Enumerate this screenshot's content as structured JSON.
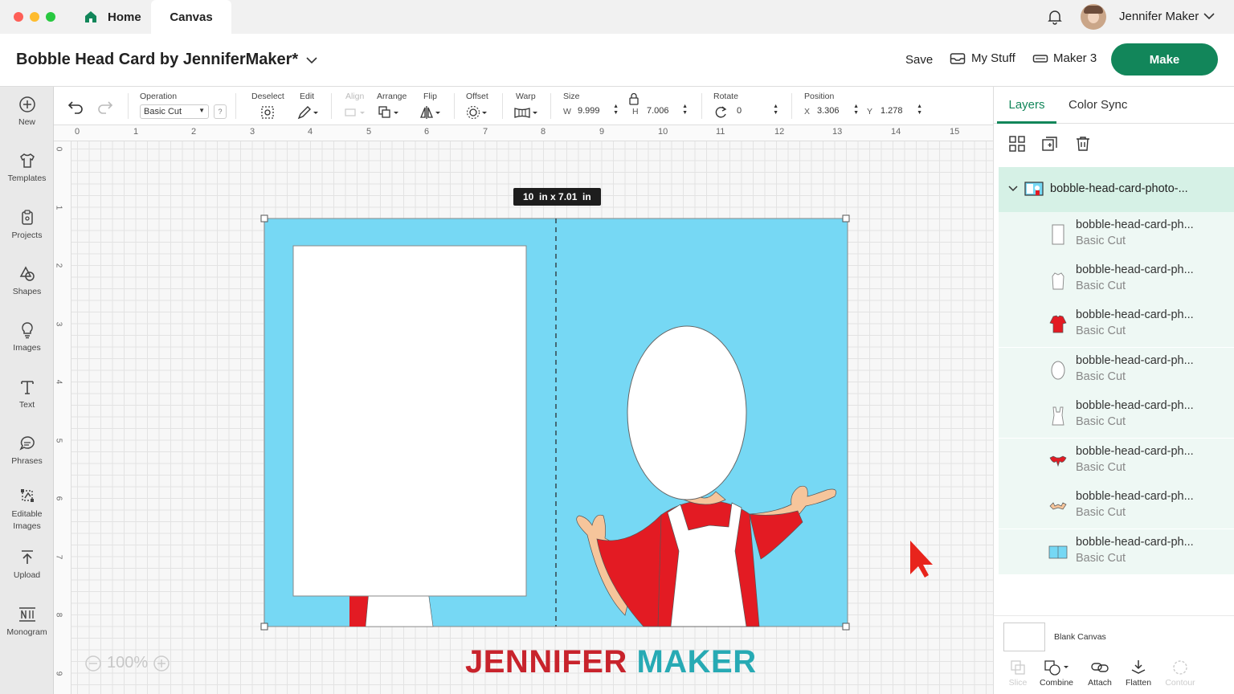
{
  "window": {
    "traffic_lights": {
      "close": "#fe5f57",
      "minimize": "#febc2e",
      "maximize": "#28c840"
    },
    "tabs": [
      {
        "label": "Home",
        "icon": "home-icon"
      },
      {
        "label": "Canvas"
      }
    ],
    "notification_icon": "bell-icon",
    "user_name": "Jennifer Maker"
  },
  "header": {
    "project_title": "Bobble Head Card by JenniferMaker*",
    "save_label": "Save",
    "my_stuff_label": "My Stuff",
    "machine_label": "Maker 3",
    "make_label": "Make",
    "accent_color": "#12865a"
  },
  "sidebar": {
    "items": [
      {
        "label": "New",
        "icon": "plus-circle-icon"
      },
      {
        "label": "Templates",
        "icon": "shirt-icon"
      },
      {
        "label": "Projects",
        "icon": "clipboard-icon"
      },
      {
        "label": "Shapes",
        "icon": "shapes-icon"
      },
      {
        "label": "Images",
        "icon": "lightbulb-icon"
      },
      {
        "label": "Text",
        "icon": "text-icon"
      },
      {
        "label": "Phrases",
        "icon": "speech-bubble-icon"
      },
      {
        "label": "Editable Images",
        "icon": "editable-images-icon"
      },
      {
        "label": "Upload",
        "icon": "upload-icon"
      },
      {
        "label": "Monogram",
        "icon": "monogram-icon"
      }
    ]
  },
  "toolbar": {
    "operation_label": "Operation",
    "operation_value": "Basic Cut",
    "help_label": "?",
    "deselect_label": "Deselect",
    "edit_label": "Edit",
    "align_label": "Align",
    "arrange_label": "Arrange",
    "flip_label": "Flip",
    "offset_label": "Offset",
    "warp_label": "Warp",
    "size_label": "Size",
    "w_label": "W",
    "w_value": "9.999",
    "h_label": "H",
    "h_value": "7.006",
    "rotate_label": "Rotate",
    "rotate_value": "0",
    "position_label": "Position",
    "x_label": "X",
    "x_value": "3.306",
    "y_label": "Y",
    "y_value": "1.278"
  },
  "canvas": {
    "ruler_top": [
      "0",
      "1",
      "2",
      "3",
      "4",
      "5",
      "6",
      "7",
      "8",
      "9",
      "10",
      "11",
      "12",
      "13",
      "14",
      "15"
    ],
    "ruler_left": [
      "0",
      "1",
      "2",
      "3",
      "4",
      "5",
      "6",
      "7",
      "8",
      "9"
    ],
    "size_tooltip": "10  in x 7.01  in",
    "zoom": "100%",
    "card_color": "#76d8f4",
    "watermark_text": "JENNIFERMAKER"
  },
  "panel": {
    "tabs": [
      "Layers",
      "Color Sync"
    ],
    "group_name": "bobble-head-card-photo-...",
    "layers": [
      {
        "name": "bobble-head-card-ph...",
        "op": "Basic Cut",
        "thumb": "white-rect-thumb"
      },
      {
        "name": "bobble-head-card-ph...",
        "op": "Basic Cut",
        "thumb": "outline-body-thumb"
      },
      {
        "name": "bobble-head-card-ph...",
        "op": "Basic Cut",
        "thumb": "red-shirt-thumb"
      },
      {
        "name": "bobble-head-card-ph...",
        "op": "Basic Cut",
        "thumb": "white-oval-thumb"
      },
      {
        "name": "bobble-head-card-ph...",
        "op": "Basic Cut",
        "thumb": "apron-thumb"
      },
      {
        "name": "bobble-head-card-ph...",
        "op": "Basic Cut",
        "thumb": "red-sleeves-thumb"
      },
      {
        "name": "bobble-head-card-ph...",
        "op": "Basic Cut",
        "thumb": "skin-hands-thumb"
      },
      {
        "name": "bobble-head-card-ph...",
        "op": "Basic Cut",
        "thumb": "blue-card-thumb"
      }
    ],
    "blank_canvas_label": "Blank Canvas",
    "bottom_actions": [
      {
        "label": "Slice",
        "enabled": false
      },
      {
        "label": "Combine",
        "enabled": true
      },
      {
        "label": "Attach",
        "enabled": true
      },
      {
        "label": "Flatten",
        "enabled": true
      },
      {
        "label": "Contour",
        "enabled": false
      }
    ]
  }
}
